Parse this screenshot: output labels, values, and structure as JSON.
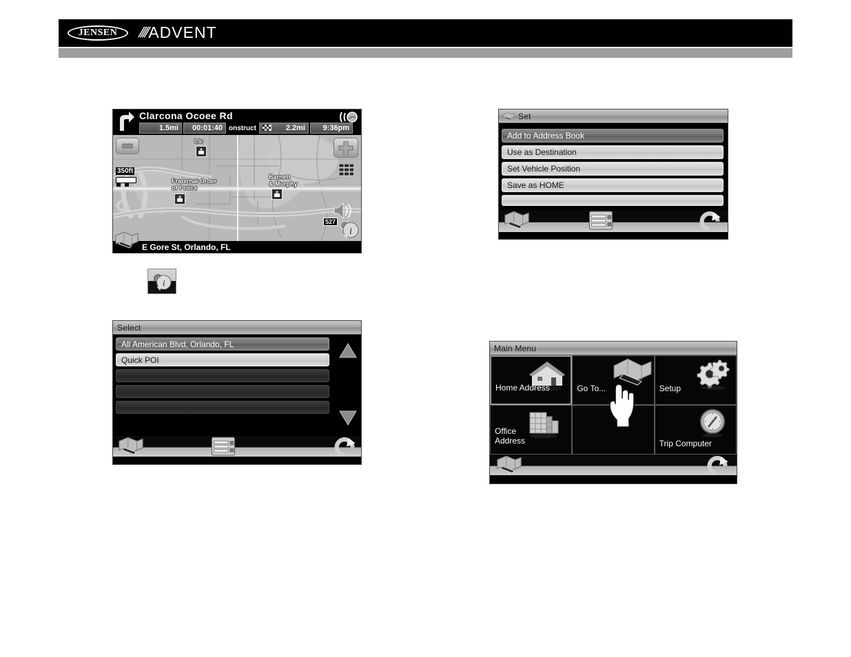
{
  "header": {
    "brand_primary": "JENSEN",
    "brand_secondary": "ADVENT",
    "brand_slashes": "////",
    "bar_color": "#000000",
    "accent_color": "#9e9e9e"
  },
  "map_screen": {
    "street_name": "Clarcona Ocoee Rd",
    "turn_icon": "turn-right-arrow-icon",
    "satellite_icon": "satellite-signal-icon",
    "info_cells": [
      {
        "name": "remaining-distance",
        "value": "1.5mi"
      },
      {
        "name": "remaining-time",
        "value": "00:01:40"
      },
      {
        "name": "traffic-distance",
        "value": "2.2mi"
      },
      {
        "name": "clock",
        "value": "9:36pm"
      }
    ],
    "traffic_icon": "traffic-flag-icon",
    "construction_label": "onstruct",
    "scale_value": "350ft",
    "zoom_out_icon": "minus-icon",
    "zoom_in_icon": "plus-icon",
    "map_view_icon": "map-grid-icon",
    "volume_icon": "speaker-icon",
    "info_pin_icon": "info-pin-icon",
    "route_shield": "527",
    "pois": [
      {
        "label": "Llc",
        "icon": "poi-marker-icon"
      },
      {
        "label": "Fraternal Order\nof Police",
        "icon": "poi-marker-icon"
      },
      {
        "label": "Barnett\n& Murphy",
        "icon": "poi-marker-icon"
      }
    ],
    "status_address": "E Gore St, Orlando, FL"
  },
  "callout_button": {
    "icon": "info-pin-icon",
    "label": ""
  },
  "select_screen": {
    "title": "Select",
    "rows": [
      {
        "label": "All American Blvd, Orlando, FL",
        "state": "selected"
      },
      {
        "label": "Quick POI",
        "state": "light"
      },
      {
        "label": "",
        "state": "empty"
      },
      {
        "label": "",
        "state": "empty"
      },
      {
        "label": "",
        "state": "empty"
      }
    ],
    "scroll_up_icon": "scroll-up-arrow-icon",
    "scroll_down_icon": "scroll-down-arrow-icon",
    "toolbar": [
      {
        "name": "map-button",
        "icon": "map-book-icon"
      },
      {
        "name": "list-button",
        "icon": "list-menu-icon"
      },
      {
        "name": "back-button",
        "icon": "return-arrow-icon"
      }
    ]
  },
  "set_screen": {
    "title": "Set",
    "title_icon": "map-book-icon",
    "rows": [
      {
        "label": "Add to Address Book",
        "state": "selected"
      },
      {
        "label": "Use as Destination",
        "state": "light"
      },
      {
        "label": "Set Vehicle Position",
        "state": "light"
      },
      {
        "label": "Save as HOME",
        "state": "light"
      },
      {
        "label": "",
        "state": "light-empty"
      }
    ],
    "toolbar": [
      {
        "name": "map-button",
        "icon": "map-book-icon"
      },
      {
        "name": "list-button",
        "icon": "list-menu-icon"
      },
      {
        "name": "back-button",
        "icon": "return-arrow-icon"
      }
    ]
  },
  "main_menu_screen": {
    "title": "Main Menu",
    "tiles": [
      {
        "label": "Home Address",
        "icon": "house-icon",
        "state": "selected"
      },
      {
        "label": "Go To...",
        "icon": "map-book-icon",
        "state": "normal",
        "cursor": "hand-pointer-icon"
      },
      {
        "label": "Setup",
        "icon": "gears-icon",
        "state": "normal"
      },
      {
        "label": "Office\nAddress",
        "icon": "office-building-icon",
        "state": "normal"
      },
      {
        "label": "",
        "icon": "",
        "state": "empty"
      },
      {
        "label": "Trip Computer",
        "icon": "compass-gauge-icon",
        "state": "normal"
      }
    ],
    "toolbar": [
      {
        "name": "map-button",
        "icon": "map-book-icon"
      },
      {
        "name": "back-button",
        "icon": "return-arrow-icon"
      }
    ]
  }
}
